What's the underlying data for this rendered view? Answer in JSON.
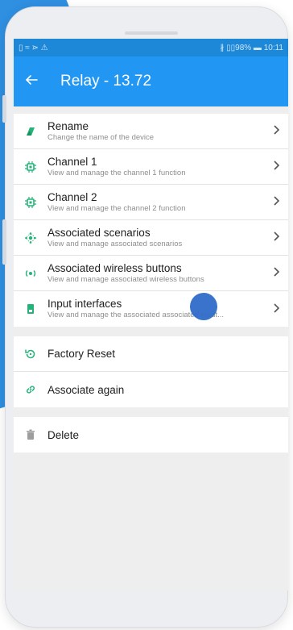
{
  "status_bar": {
    "left": "▯ ≈ ⋗ ⚠",
    "right": "∦ ▯▯98% ▬ 10:11"
  },
  "app_bar": {
    "back_icon": "arrow-left-icon",
    "title": "Relay - 13.72"
  },
  "menu_items": [
    {
      "title": "Rename",
      "subtitle": "Change the name of the device",
      "icon": "tag-icon"
    },
    {
      "title": "Channel 1",
      "subtitle": "View and manage the channel 1 function",
      "icon": "chip-icon"
    },
    {
      "title": "Channel 2",
      "subtitle": "View and manage the channel 2 function",
      "icon": "chip-icon"
    },
    {
      "title": "Associated scenarios",
      "subtitle": "View and manage associated scenarios",
      "icon": "scenario-icon"
    },
    {
      "title": "Associated wireless buttons",
      "subtitle": "View and manage associated wireless buttons",
      "icon": "wireless-icon"
    },
    {
      "title": "Input interfaces",
      "subtitle": "View and manage the associated associated input...",
      "icon": "input-icon"
    }
  ],
  "actions": [
    {
      "title": "Factory Reset",
      "icon": "reset-icon"
    },
    {
      "title": "Associate again",
      "icon": "link-icon"
    }
  ],
  "delete": {
    "title": "Delete",
    "icon": "trash-icon"
  },
  "colors": {
    "primary": "#2196f3",
    "statusbar": "#1e88d8",
    "icon_green": "#26b37a",
    "background": "#eeeeee"
  }
}
